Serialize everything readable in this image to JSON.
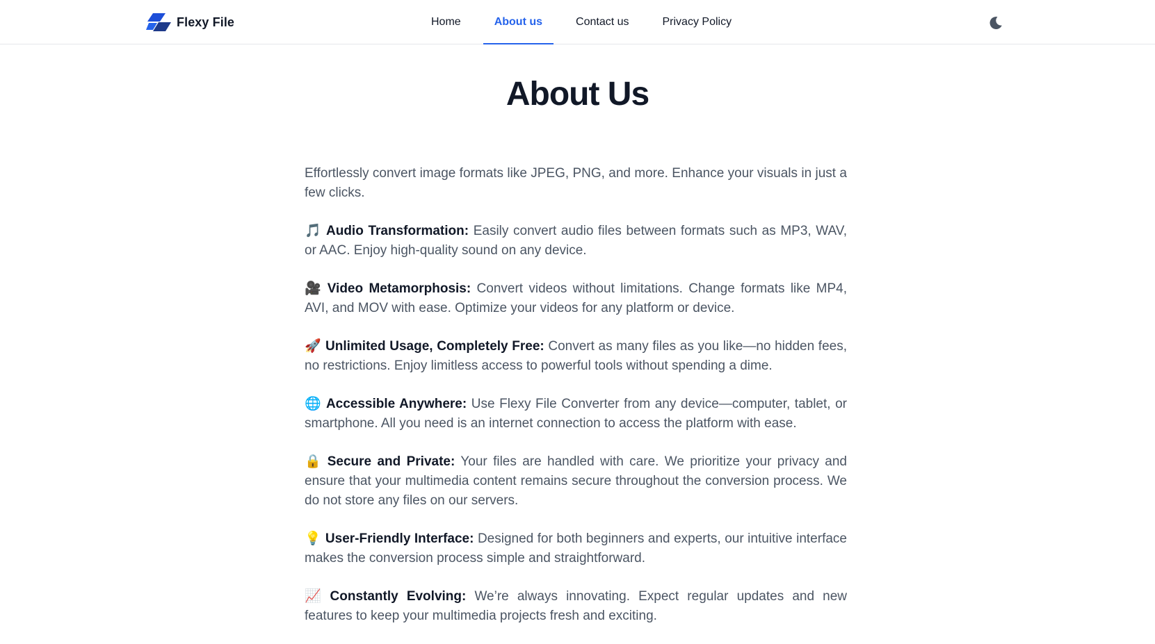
{
  "header": {
    "brand_name": "Flexy File",
    "brand_color": "#1e40af",
    "nav": [
      {
        "label": "Home",
        "active": false
      },
      {
        "label": "About us",
        "active": true
      },
      {
        "label": "Contact us",
        "active": false
      },
      {
        "label": "Privacy Policy",
        "active": false
      }
    ],
    "accent_color": "#2563eb",
    "theme_toggle_icon": "moon-icon"
  },
  "main": {
    "title": "About Us",
    "intro": "Effortlessly convert image formats like JPEG, PNG, and more. Enhance your visuals in just a few clicks.",
    "features": [
      {
        "icon": "musical-note-icon",
        "emoji": "🎵",
        "title": "Audio Transformation:",
        "text": "Easily convert audio files between formats such as MP3, WAV, or AAC. Enjoy high-quality sound on any device."
      },
      {
        "icon": "movie-camera-icon",
        "emoji": "🎥",
        "title": "Video Metamorphosis:",
        "text": "Convert videos without limitations. Change formats like MP4, AVI, and MOV with ease. Optimize your videos for any platform or device."
      },
      {
        "icon": "rocket-icon",
        "emoji": "🚀",
        "title": "Unlimited Usage, Completely Free:",
        "text": "Convert as many files as you like—no hidden fees, no restrictions. Enjoy limitless access to powerful tools without spending a dime."
      },
      {
        "icon": "globe-icon",
        "emoji": "🌐",
        "title": "Accessible Anywhere:",
        "text": "Use Flexy File Converter from any device—computer, tablet, or smartphone. All you need is an internet connection to access the platform with ease."
      },
      {
        "icon": "lock-icon",
        "emoji": "🔒",
        "title": "Secure and Private:",
        "text": "Your files are handled with care. We prioritize your privacy and ensure that your multimedia content remains secure throughout the conversion process. We do not store any files on our servers."
      },
      {
        "icon": "light-bulb-icon",
        "emoji": "💡",
        "title": "User-Friendly Interface:",
        "text": "Designed for both beginners and experts, our intuitive interface makes the conversion process simple and straightforward."
      },
      {
        "icon": "chart-increasing-icon",
        "emoji": "📈",
        "title": "Constantly Evolving:",
        "text": "We’re always innovating. Expect regular updates and new features to keep your multimedia projects fresh and exciting."
      }
    ]
  }
}
